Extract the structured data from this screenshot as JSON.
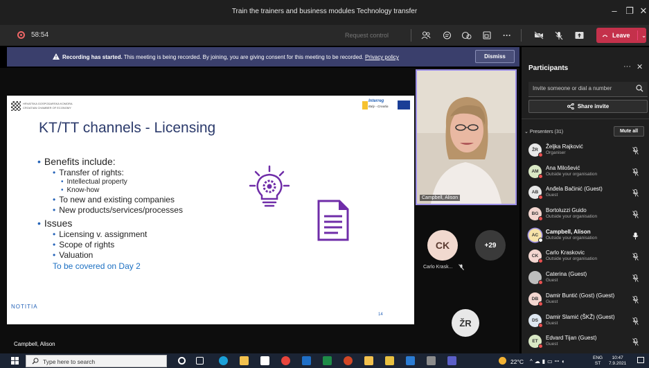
{
  "window": {
    "title": "Train the trainers and business modules Technology transfer"
  },
  "toolbar": {
    "timer": "58:54",
    "request_control": "Request control",
    "leave_label": "Leave"
  },
  "banner": {
    "title": "Recording has started.",
    "message": "This meeting is being recorded. By joining, you are giving consent for this meeting to be recorded.",
    "privacy_link": "Privacy policy",
    "dismiss_label": "Dismiss"
  },
  "slide": {
    "org_line1": "HRVATSKA GOSPODARSKA KOMORA",
    "org_line2": "CROATIAN CHAMBER OF ECONOMY",
    "interreg_line1": "Interreg",
    "interreg_line2": "Italy - Croatia",
    "title": "KT/TT channels - Licensing",
    "bullets": [
      {
        "level": 1,
        "text": "Benefits include:"
      },
      {
        "level": 2,
        "text": "Transfer of rights:"
      },
      {
        "level": 3,
        "text": "Intellectual property"
      },
      {
        "level": 3,
        "text": "Know-how"
      },
      {
        "level": 2,
        "text": "To new and existing companies"
      },
      {
        "level": 2,
        "text": "New products/services/processes"
      },
      {
        "level": 1,
        "text": "Issues"
      },
      {
        "level": 2,
        "text": "Licensing v. assignment"
      },
      {
        "level": 2,
        "text": "Scope of rights"
      },
      {
        "level": 2,
        "text": "Valuation"
      }
    ],
    "note": "To be covered on Day 2",
    "footer_text": "NOTITIA",
    "page_number": "14",
    "colors": {
      "accent": "#6f2da8",
      "bullet": "#2563b8",
      "link": "#1b6fc2"
    }
  },
  "stage": {
    "video_label": "Campbell, Alison",
    "tile_ck_initials": "CK",
    "tile_ck_name": "Carlo Krask...",
    "overflow_count": "+29",
    "tile_zr_initials": "ŽR",
    "presenting_label": "Campbell, Alison"
  },
  "panel": {
    "title": "Participants",
    "invite_placeholder": "Invite someone or dial a number",
    "share_invite_label": "Share invite",
    "presenters_label": "Presenters (31)",
    "mute_all_label": "Mute all",
    "participants": [
      {
        "initials": "ŽR",
        "name": "Željka Rajković",
        "sub": "Organiser",
        "color": "#e8e8e8",
        "mic": "muted"
      },
      {
        "initials": "AM",
        "name": "Ana Milošević",
        "sub": "Outside your organisation",
        "color": "#d9e8c4",
        "mic": "muted"
      },
      {
        "initials": "AB",
        "name": "Anđela Bačinić (Guest)",
        "sub": "Guest",
        "color": "#e8e8e8",
        "mic": "muted"
      },
      {
        "initials": "BG",
        "name": "Bortoluzzi Guido",
        "sub": "Outside your organisation",
        "color": "#f3d6d0",
        "mic": "muted"
      },
      {
        "initials": "AC",
        "name": "Campbell, Alison",
        "sub": "Outside your organisation",
        "color": "#f6e3a8",
        "mic": "on"
      },
      {
        "initials": "CK",
        "name": "Carlo Kraskovic",
        "sub": "Outside your organisation",
        "color": "#f3d6d0",
        "mic": "muted"
      },
      {
        "initials": "",
        "name": "Caterina (Guest)",
        "sub": "Guest",
        "color": "#bdbdbd",
        "mic": "muted"
      },
      {
        "initials": "DB",
        "name": "Damir Buntić (Gost) (Guest)",
        "sub": "Guest",
        "color": "#f3d6d0",
        "mic": "muted"
      },
      {
        "initials": "DS",
        "name": "Damir Slamić (ŠKŽ) (Guest)",
        "sub": "Guest",
        "color": "#dde6f0",
        "mic": "muted"
      },
      {
        "initials": "ET",
        "name": "Edvard Tijan (Guest)",
        "sub": "Guest",
        "color": "#d9e8c4",
        "mic": "muted"
      }
    ]
  },
  "taskbar": {
    "search_placeholder": "Type here to search",
    "temperature": "22°C",
    "language_line1": "ENG",
    "language_line2": "ST",
    "time": "10:47",
    "date": "7.9.2021"
  }
}
